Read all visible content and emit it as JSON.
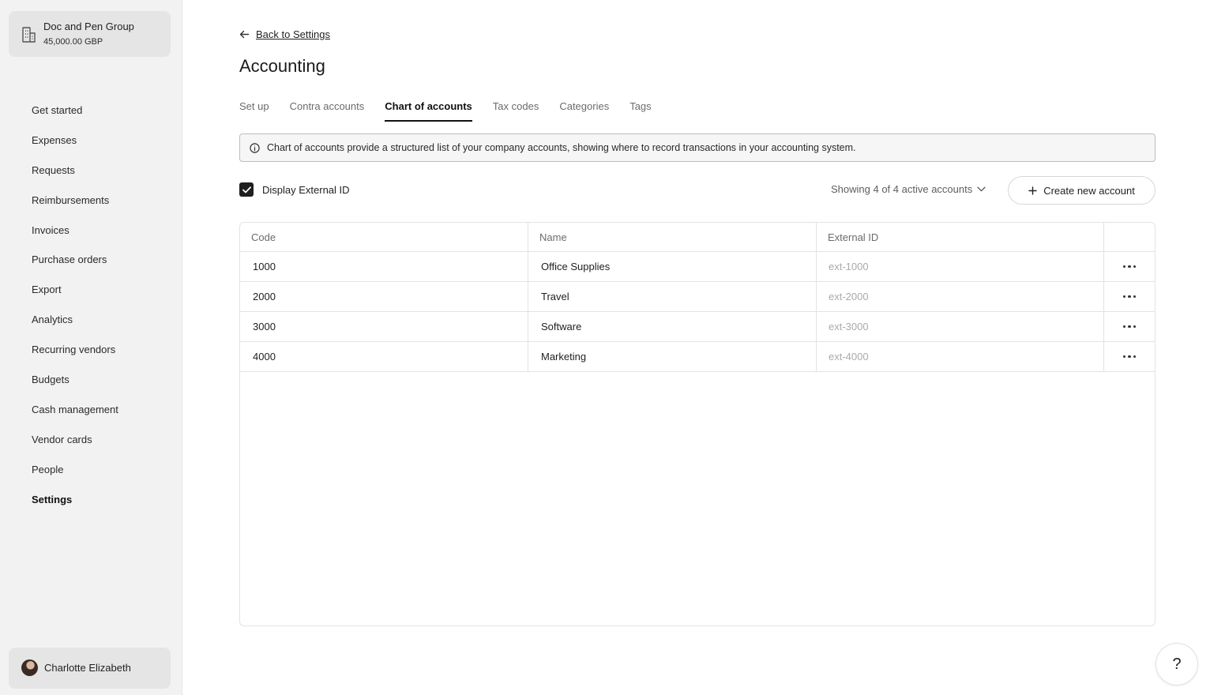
{
  "company": {
    "name": "Doc and Pen Group",
    "balance": "45,000.00 GBP",
    "icon": "building-icon"
  },
  "nav": {
    "items": [
      {
        "label": "Get started"
      },
      {
        "label": "Expenses"
      },
      {
        "label": "Requests"
      },
      {
        "label": "Reimbursements"
      },
      {
        "label": "Invoices"
      },
      {
        "label": "Purchase orders"
      },
      {
        "label": "Export"
      },
      {
        "label": "Analytics"
      },
      {
        "label": "Recurring vendors"
      },
      {
        "label": "Budgets"
      },
      {
        "label": "Cash management"
      },
      {
        "label": "Vendor cards"
      },
      {
        "label": "People"
      },
      {
        "label": "Settings"
      }
    ],
    "active": "Settings"
  },
  "user": {
    "name": "Charlotte Elizabeth"
  },
  "back": {
    "label": "Back to Settings"
  },
  "page": {
    "title": "Accounting"
  },
  "tabs": [
    {
      "label": "Set up"
    },
    {
      "label": "Contra accounts"
    },
    {
      "label": "Chart of accounts"
    },
    {
      "label": "Tax codes"
    },
    {
      "label": "Categories"
    },
    {
      "label": "Tags"
    }
  ],
  "active_tab": "Chart of accounts",
  "info": {
    "text": "Chart of accounts provide a structured list of your company accounts, showing where to record transactions in your accounting system."
  },
  "display_external": {
    "label": "Display External ID",
    "checked": true
  },
  "showing": {
    "label": "Showing 4 of 4 active accounts"
  },
  "create": {
    "label": "Create new account"
  },
  "table": {
    "headers": {
      "code": "Code",
      "name": "Name",
      "external": "External ID"
    },
    "rows": [
      {
        "code": "1000",
        "name": "Office Supplies",
        "external": "ext-1000"
      },
      {
        "code": "2000",
        "name": "Travel",
        "external": "ext-2000"
      },
      {
        "code": "3000",
        "name": "Software",
        "external": "ext-3000"
      },
      {
        "code": "4000",
        "name": "Marketing",
        "external": "ext-4000"
      }
    ]
  },
  "help": {
    "label": "?"
  }
}
